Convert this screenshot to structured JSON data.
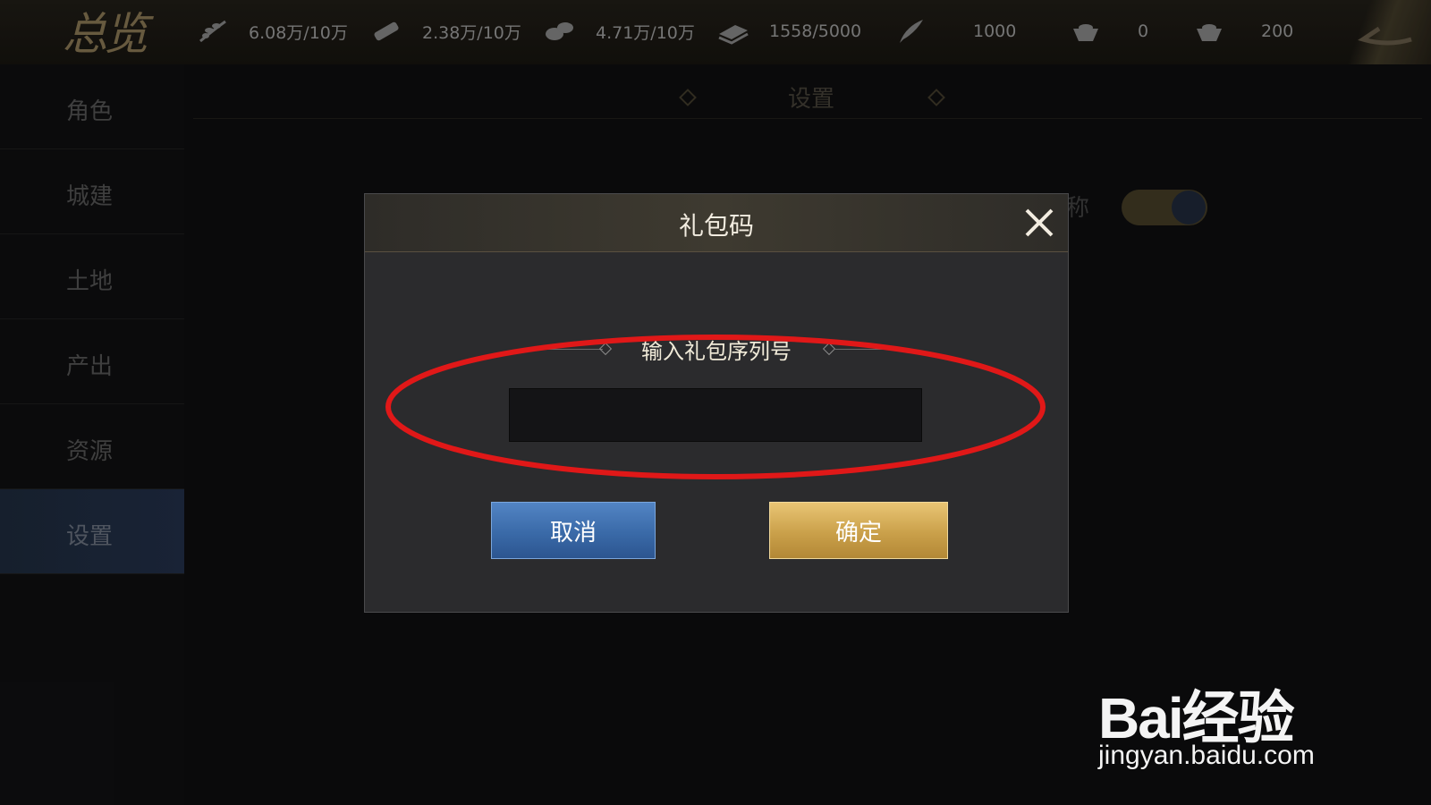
{
  "topbar": {
    "logo_text": "总览",
    "resources": [
      {
        "icon": "grain-icon",
        "value": "6.08万/10万"
      },
      {
        "icon": "wood-icon",
        "value": "2.38万/10万"
      },
      {
        "icon": "stone-icon",
        "value": "4.71万/10万"
      },
      {
        "icon": "iron-icon",
        "value": "1558/5000"
      },
      {
        "icon": "feather-icon",
        "value": "1000"
      },
      {
        "icon": "ingot-icon",
        "value": "0"
      },
      {
        "icon": "gold-ingot-icon",
        "value": "200"
      }
    ]
  },
  "sidebar": {
    "items": [
      {
        "label": "角色"
      },
      {
        "label": "城建"
      },
      {
        "label": "土地"
      },
      {
        "label": "产出"
      },
      {
        "label": "资源"
      },
      {
        "label": "设置",
        "active": true
      }
    ]
  },
  "main": {
    "title": "设置",
    "background_partial_text": "称"
  },
  "dialog": {
    "title": "礼包码",
    "field_label": "输入礼包序列号",
    "input_value": "",
    "cancel_label": "取消",
    "confirm_label": "确定"
  },
  "watermark": {
    "logo": "Bai经验",
    "url": "jingyan.baidu.com"
  },
  "colors": {
    "highlight": "#e01818",
    "cancel_blue": "#3a6aa8",
    "confirm_gold": "#caa04a"
  }
}
